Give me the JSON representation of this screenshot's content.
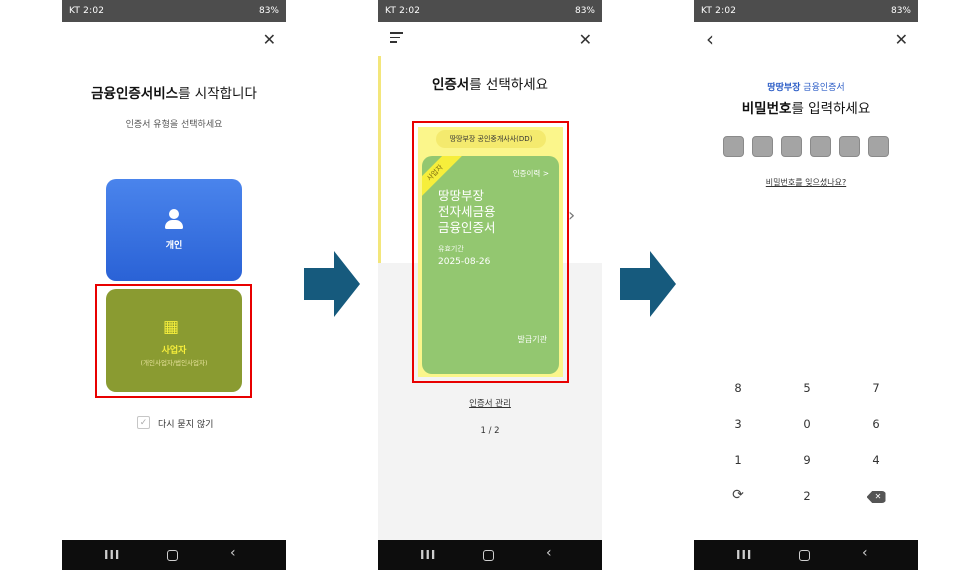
{
  "status": {
    "left": "KT 2:02",
    "right": "83%"
  },
  "panel1": {
    "title_bold": "금융인증서비스",
    "title_rest": "를 시작합니다",
    "subtitle": "인증서 유형을 선택하세요",
    "personal_label": "개인",
    "business_label": "사업자",
    "business_sub": "(개인사업자/법인사업자)",
    "dont_ask_label": "다시 묻지 않기"
  },
  "panel2": {
    "title_bold": "인증서",
    "title_rest": "를 선택하세요",
    "pill_label": "땅땅부장 공인중개사사(DD)",
    "ribbon": "사업자",
    "history_link": "인증이력 >",
    "card_name_line1": "땅땅부장",
    "card_name_line2": "전자세금용",
    "card_name_line3": "금융인증서",
    "valid_label": "유효기간",
    "valid_date": "2025-08-26",
    "issuer": "발급기관",
    "manage_link": "인증서 관리",
    "pager": "1 / 2"
  },
  "panel3": {
    "cert_bold": "땅땅부장",
    "cert_rest": " 금융인증서",
    "title_bold": "비밀번호",
    "title_rest": "를 입력하세요",
    "forgot_link": "비밀번호를 잊으셨나요?",
    "keys": [
      "8",
      "5",
      "7",
      "3",
      "0",
      "6",
      "1",
      "9",
      "4",
      "2"
    ]
  },
  "colors": {
    "personal_blue": "#3a74e2",
    "business_olive": "#8a9b31",
    "card_green": "#93c770",
    "card_yellow": "#fbf68b",
    "highlight_red": "#e80000",
    "arrow_teal": "#165a7d"
  }
}
